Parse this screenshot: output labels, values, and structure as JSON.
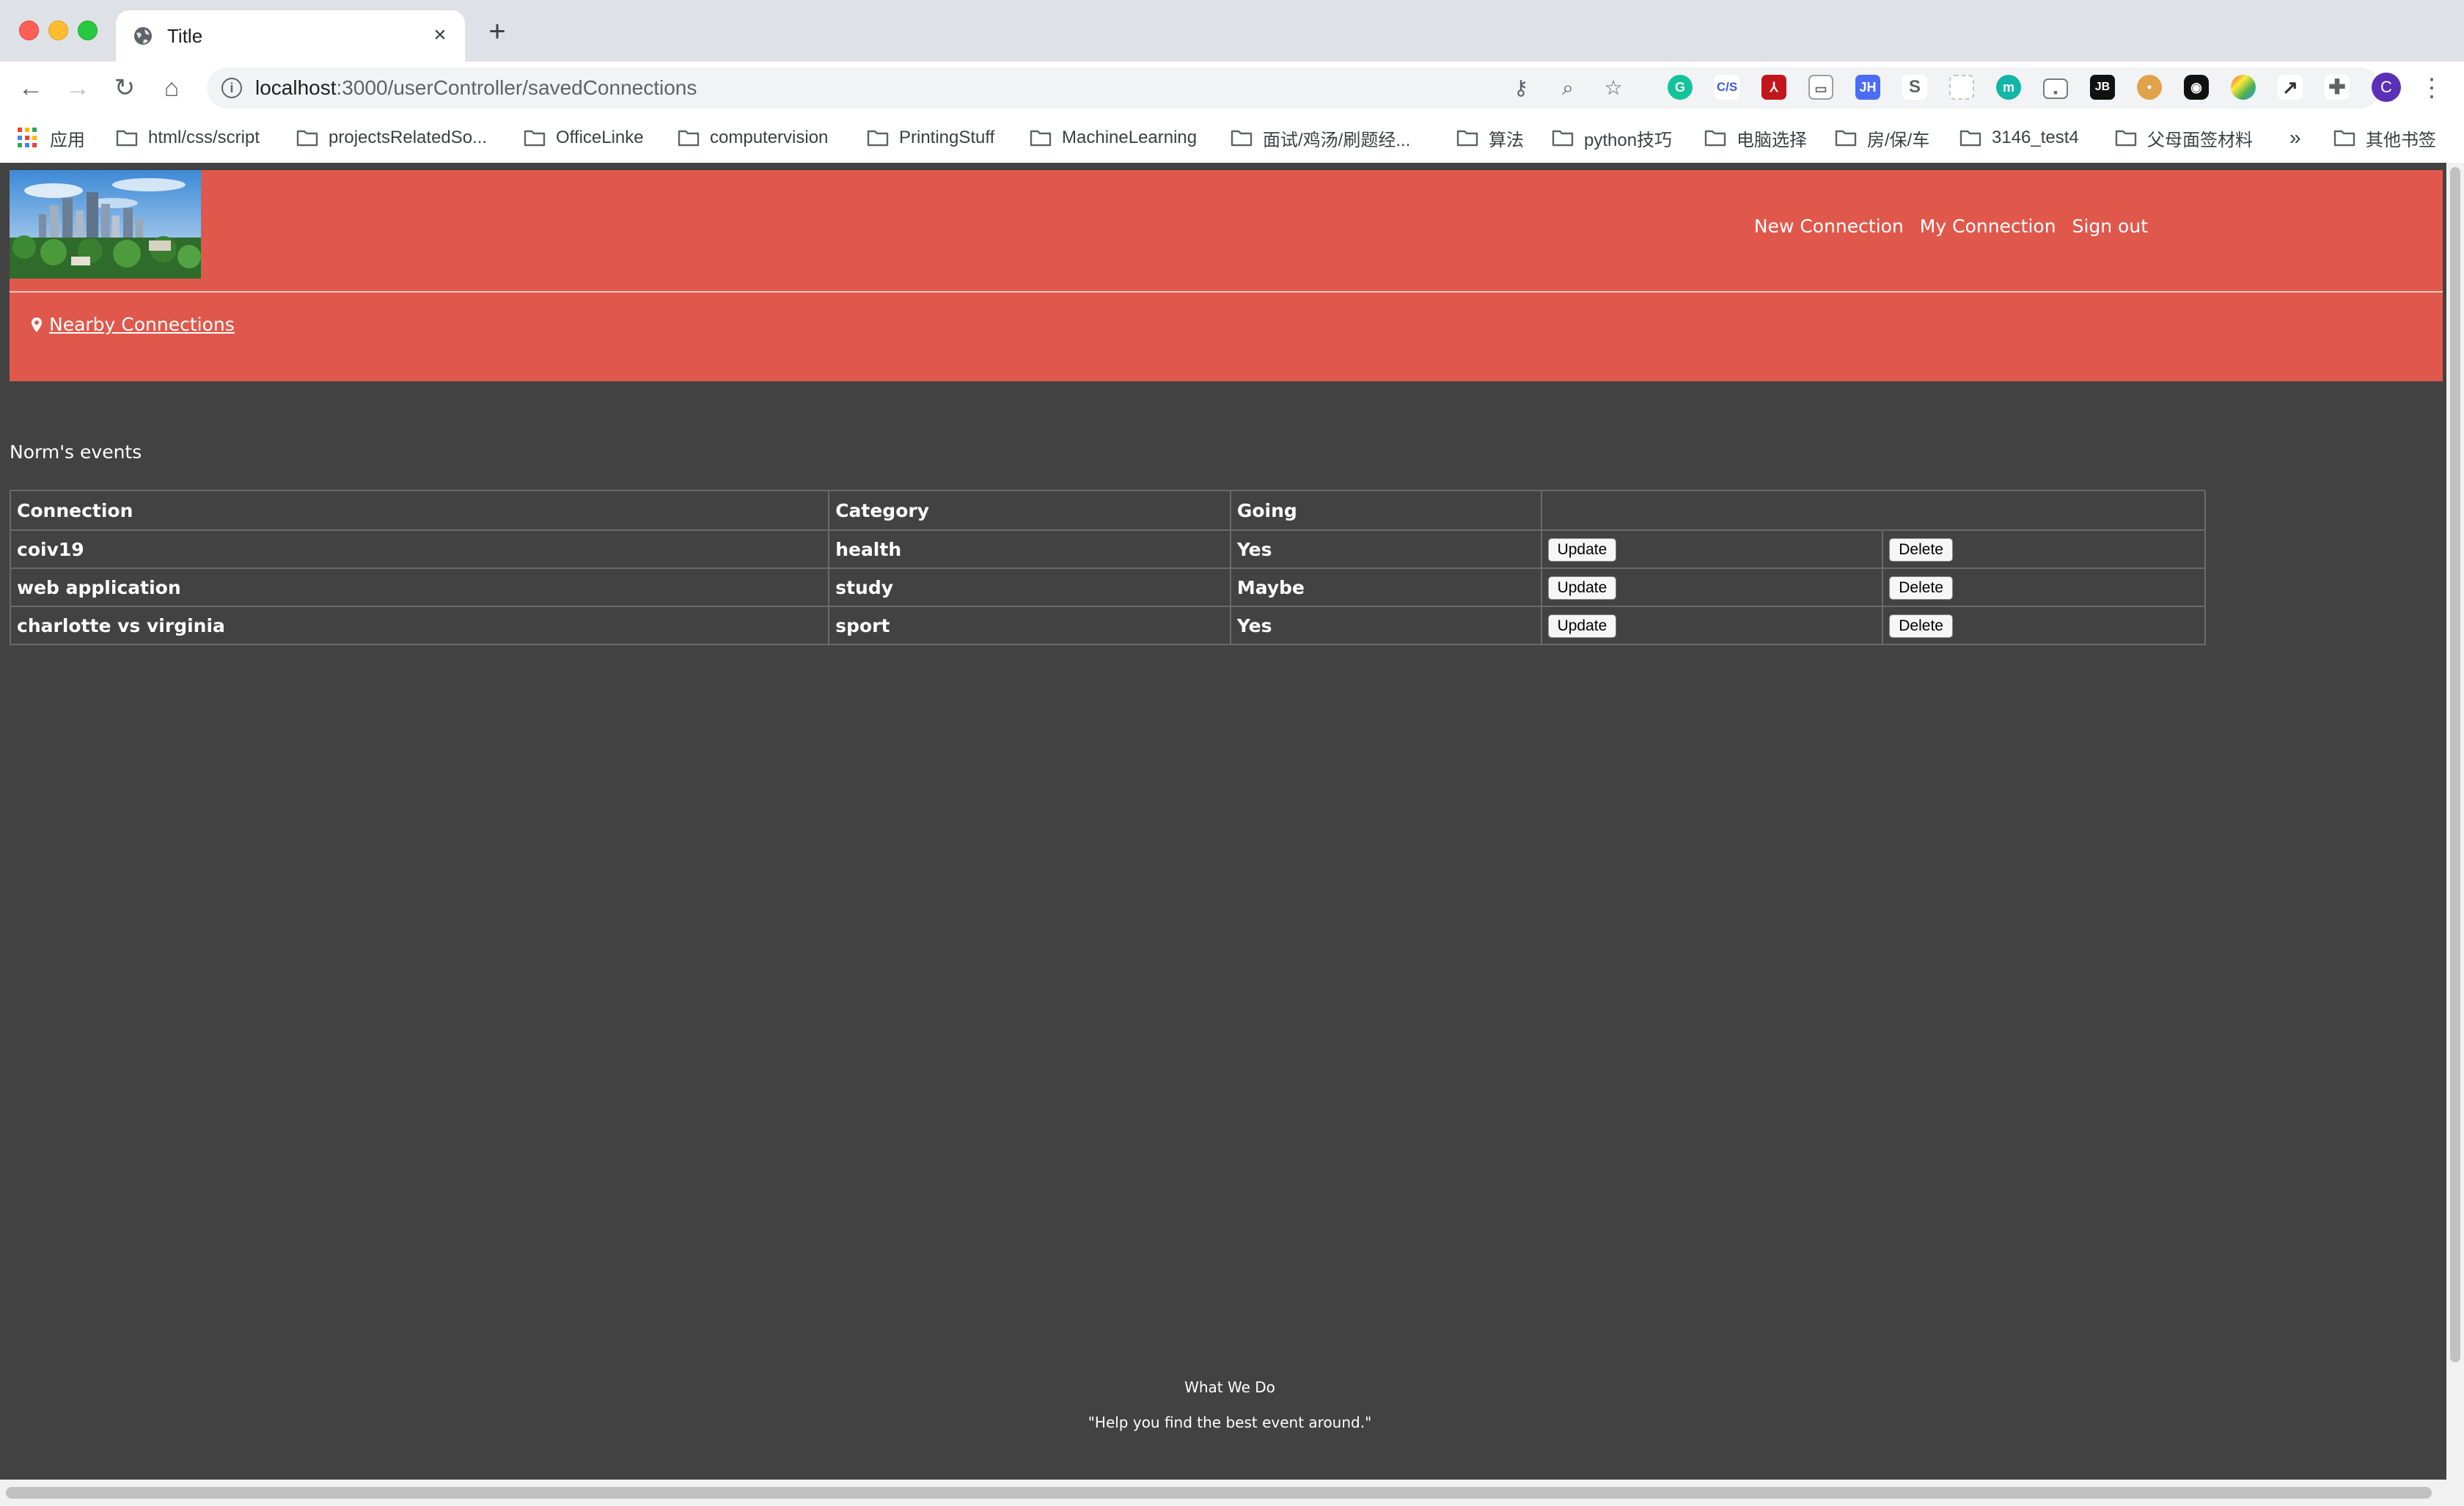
{
  "browser": {
    "tab_title": "Title",
    "url_host": "localhost",
    "url_rest": ":3000/userController/savedConnections",
    "bookmarks": [
      "应用",
      "html/css/script",
      "projectsRelatedSo...",
      "OfficeLinke",
      "computervision",
      "PrintingStuff",
      "MachineLearning",
      "面试/鸡汤/刷题经...",
      "算法",
      "python技巧",
      "电脑选择",
      "房/保/车",
      "3146_test4",
      "父母面签材料",
      "»",
      "其他书签"
    ],
    "extensions": [
      "grammarly-icon",
      "css-icon",
      "pdf-icon",
      "cast-icon",
      "jh-icon",
      "s-icon",
      "dashed-icon",
      "m-icon",
      "wallet-icon",
      "jb-icon",
      "cookie-icon",
      "dark-icon",
      "colorful-icon",
      "chart-icon",
      "puzzle-icon",
      "profile-avatar"
    ],
    "ext_labels": {
      "css": "C/S",
      "jh": "JH",
      "s": "S",
      "m": "m",
      "jb": "JB",
      "avatar": "C"
    }
  },
  "header": {
    "nav": [
      "New Connection",
      "My Connection",
      "Sign out"
    ],
    "nearby_link": "Nearby Connections"
  },
  "main": {
    "title": "Norm's events",
    "columns": [
      "Connection",
      "Category",
      "Going",
      ""
    ],
    "rows": [
      {
        "connection": "coiv19",
        "category": "health",
        "going": "Yes"
      },
      {
        "connection": "web application",
        "category": "study",
        "going": "Maybe"
      },
      {
        "connection": "charlotte vs virginia",
        "category": "sport",
        "going": "Yes"
      }
    ],
    "update_label": "Update",
    "delete_label": "Delete"
  },
  "footer": {
    "title": "What We Do",
    "quote": "\"Help you find the best event around.\""
  },
  "colors": {
    "header_bg": "#e0584b",
    "page_bg": "#424242"
  }
}
